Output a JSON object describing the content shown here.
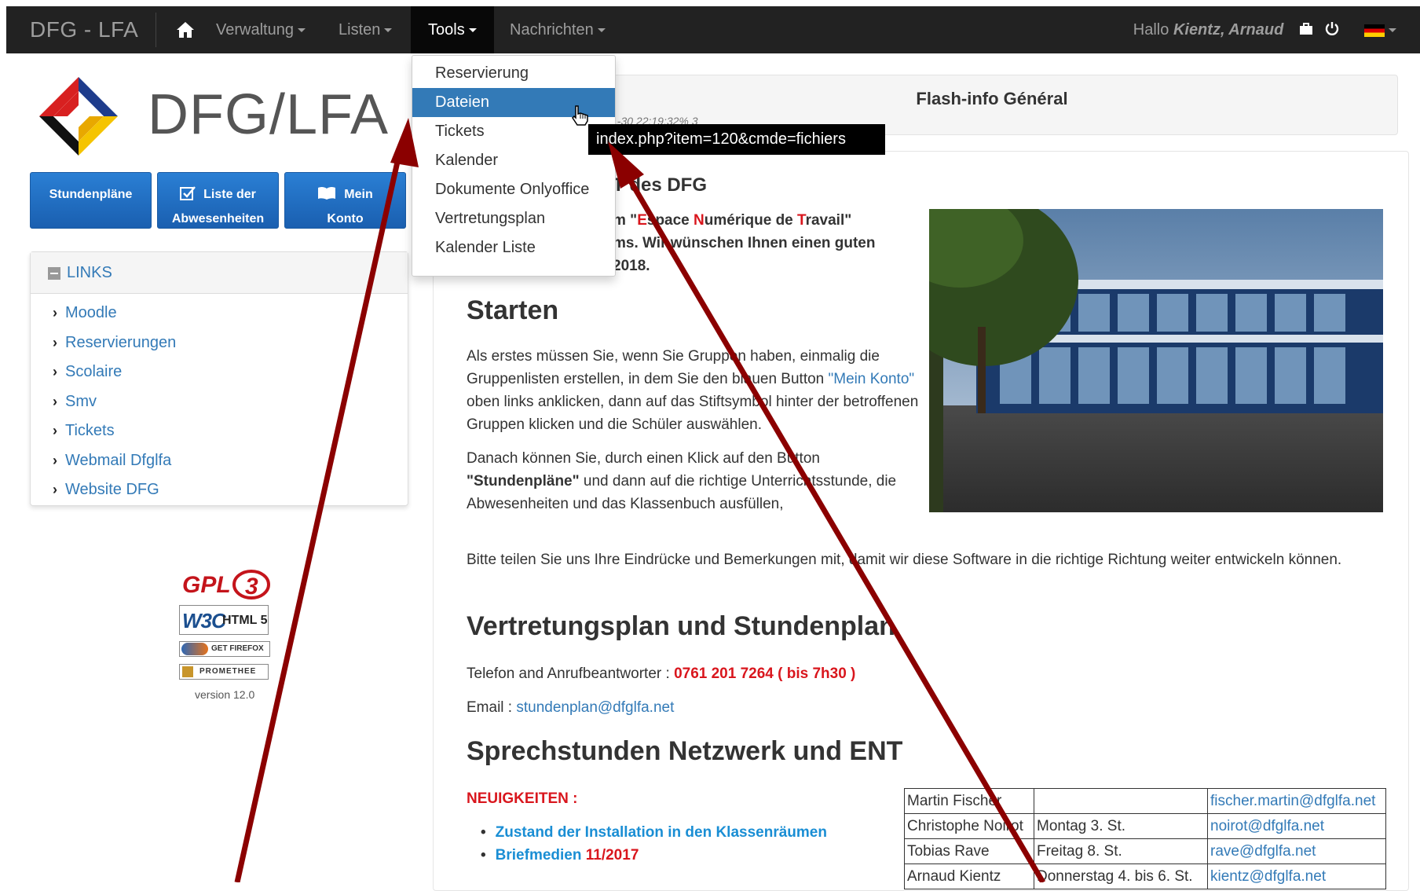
{
  "navbar": {
    "brand": "DFG - LFA",
    "items": [
      {
        "label": "Verwaltung"
      },
      {
        "label": "Listen"
      },
      {
        "label": "Tools"
      },
      {
        "label": "Nachrichten"
      }
    ],
    "greeting": "Hallo",
    "user_name": "Kientz, Arnaud",
    "home_icon": "home-icon",
    "flag": "german-flag"
  },
  "tools_menu": {
    "items": [
      {
        "label": "Reservierung"
      },
      {
        "label": "Dateien"
      },
      {
        "label": "Tickets"
      },
      {
        "label": "Kalender"
      },
      {
        "label": "Dokumente Onlyoffice"
      },
      {
        "label": "Vertretungsplan"
      },
      {
        "label": "Kalender Liste"
      }
    ],
    "hover_tooltip": "index.php?item=120&cmde=fichiers"
  },
  "logo": {
    "text": "DFG/LFA"
  },
  "buttons": [
    {
      "line1": "Stundenpläne",
      "line2": ""
    },
    {
      "line1": "Liste der",
      "line2": "Abwesenheiten"
    },
    {
      "line1": "Mein",
      "line2": "Konto"
    }
  ],
  "links_panel": {
    "title": "LINKS",
    "items": [
      "Moodle",
      "Reservierungen",
      "Scolaire",
      "Smv",
      "Tickets",
      "Webmail Dfglfa",
      "Website DFG"
    ]
  },
  "badges": {
    "gpl": "GPL",
    "gpl_version": "3",
    "w3c": "W3C",
    "html": "HTML 5",
    "firefox": "GET FIREFOX",
    "promethee": "PROMETHEE",
    "version": "version 12.0"
  },
  "flash": {
    "title": "Flash-info Général",
    "timestamp": "1-30 22:19:32% 3"
  },
  "welcome": {
    "heading": "T des DFG",
    "line1_pre": "m \"",
    "e_letter": "E",
    "e_rest": "space ",
    "n_letter": "N",
    "n_rest": "umérique de ",
    "t_letter": "T",
    "t_rest": "ravail\"",
    "line2": "ms. Wir wünschen Ihnen einen guten",
    "line3": "2018."
  },
  "starten": {
    "heading": "Starten",
    "p1_a": "Als erstes müssen Sie, wenn Sie Gruppen haben, einmalig die Gruppenlisten erstellen, in dem Sie den blauen Button ",
    "p1_link": "\"Mein Konto\"",
    "p1_b": " oben links anklicken, dann auf das Stiftsymbol hinter der betroffenen Gruppen klicken und die Schüler auswählen.",
    "p2_a": "Danach können Sie, durch einen Klick auf den Button ",
    "p2_bold": "\"Stundenpläne\"",
    "p2_b": " und dann auf die richtige Unterrichtsstunde, die Abwesenheiten und das Klassenbuch ausfüllen,",
    "p3": "Bitte teilen Sie uns Ihre Eindrücke und Bemerkungen mit, damit wir diese Software in die richtige Richtung weiter entwickeln können."
  },
  "vertretung": {
    "heading": "Vertretungsplan und Stundenplan",
    "phone_label": "Telefon and Anrufbeantworter : ",
    "phone_value": "0761 201 7264 ( bis 7h30 )",
    "email_label": "Email : ",
    "email_value": "stundenplan@dfglfa.net"
  },
  "sprechstunden": {
    "heading": "Sprechstunden Netzwerk und ENT",
    "news_label": "NEUIGKEITEN :",
    "news": [
      {
        "text": "Zustand der Installation in den Klassenräumen",
        "suffix": ""
      },
      {
        "text": "Briefmedien ",
        "suffix": "11/2017"
      }
    ],
    "table": [
      {
        "name": "Martin Fischer",
        "time": "",
        "email": "fischer.martin@dfglfa.net"
      },
      {
        "name": "Christophe Noirot",
        "time": "Montag 3. St.",
        "email": "noirot@dfglfa.net"
      },
      {
        "name": "Tobias Rave",
        "time": "Freitag 8. St.",
        "email": "rave@dfglfa.net"
      },
      {
        "name": "Arnaud Kientz",
        "time": "Donnerstag 4. bis 6. St.",
        "email": "kientz@dfglfa.net"
      }
    ]
  },
  "colors": {
    "navbar_bg": "#222222",
    "accent_blue": "#337ab7",
    "button_blue": "#1a6fc8",
    "highlight_red": "#d9161d",
    "arrow_red": "#8b0000"
  }
}
